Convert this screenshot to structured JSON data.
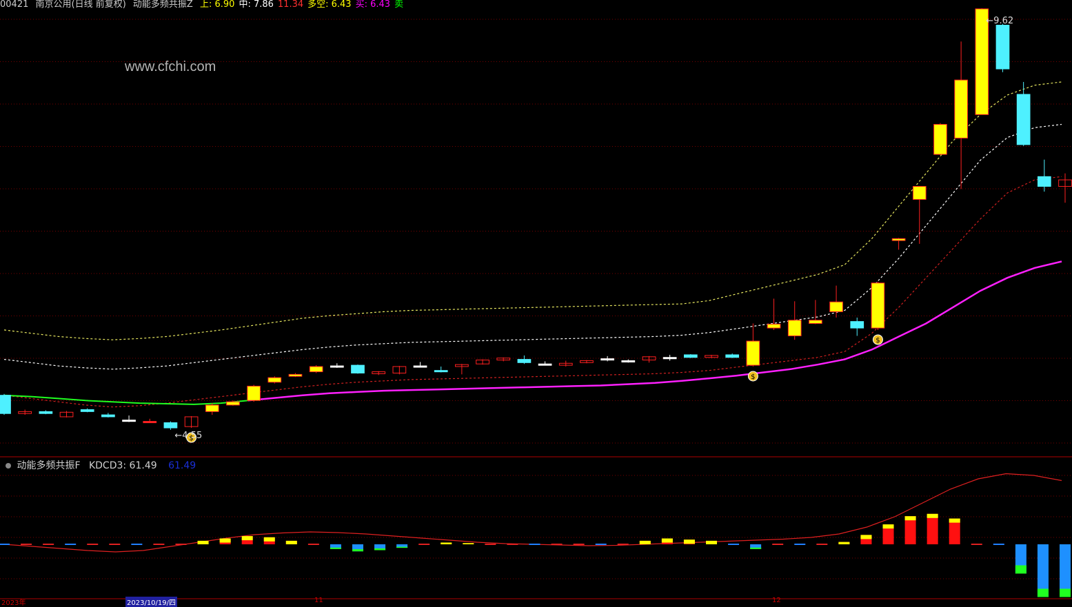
{
  "header": {
    "stock_code": "00421",
    "stock_name_period": "南京公用(日线 前复权)",
    "indicator_name": "动能多频共振Z",
    "indicator_values": [
      {
        "label": "上",
        "value": "6.90",
        "color": "#ffff00"
      },
      {
        "label": "中",
        "value": "7.86",
        "color": "#ffffff"
      },
      {
        "label": "",
        "value": "11.34",
        "color": "#ff3030"
      },
      {
        "label": "多空",
        "value": "6.43",
        "color": "#ffff00"
      },
      {
        "label": "买",
        "value": "6.43",
        "color": "#ff00ff"
      },
      {
        "label": "卖",
        "value": "",
        "color": "#00ff00"
      }
    ]
  },
  "watermark": "www.cfchi.com",
  "annotations": {
    "high_label": "9.62",
    "low_label": "4.55"
  },
  "sub_panel": {
    "title": "动能多频共振F",
    "kdcd_label": "KDCD3: 61.49",
    "kdcd_value2": "61.49"
  },
  "date_axis": {
    "labels": [
      "2023年",
      "2023/10/19/四",
      "11",
      "12"
    ]
  },
  "colors": {
    "up": "#ffff00",
    "down": "#4ef0ff",
    "flat": "#ffffff",
    "red": "#ff2020",
    "magenta": "#ff20ff",
    "green": "#20ff20",
    "grid": "#7a0000"
  },
  "chart_data": {
    "type": "candlestick",
    "price_range": [
      4.2,
      9.8
    ],
    "candles": [
      {
        "o": 5.0,
        "c": 4.72,
        "h": 5.02,
        "l": 4.7,
        "k": "down"
      },
      {
        "o": 4.72,
        "c": 4.75,
        "h": 4.78,
        "l": 4.7,
        "k": "hollow"
      },
      {
        "o": 4.75,
        "c": 4.72,
        "h": 4.77,
        "l": 4.71,
        "k": "down"
      },
      {
        "o": 4.67,
        "c": 4.74,
        "h": 4.76,
        "l": 4.66,
        "k": "hollow"
      },
      {
        "o": 4.78,
        "c": 4.75,
        "h": 4.8,
        "l": 4.74,
        "k": "down"
      },
      {
        "o": 4.7,
        "c": 4.67,
        "h": 4.73,
        "l": 4.66,
        "k": "down"
      },
      {
        "o": 4.62,
        "c": 4.62,
        "h": 4.69,
        "l": 4.59,
        "k": "flat"
      },
      {
        "o": 4.6,
        "c": 4.6,
        "h": 4.64,
        "l": 4.58,
        "k": "red"
      },
      {
        "o": 4.58,
        "c": 4.5,
        "h": 4.6,
        "l": 4.47,
        "k": "down"
      },
      {
        "o": 4.52,
        "c": 4.67,
        "h": 4.68,
        "l": 4.5,
        "k": "hollow"
      },
      {
        "o": 4.75,
        "c": 4.85,
        "h": 4.88,
        "l": 4.7,
        "k": "up"
      },
      {
        "o": 4.85,
        "c": 4.9,
        "h": 4.92,
        "l": 4.84,
        "k": "up"
      },
      {
        "o": 4.92,
        "c": 5.14,
        "h": 5.16,
        "l": 4.9,
        "k": "up"
      },
      {
        "o": 5.2,
        "c": 5.27,
        "h": 5.29,
        "l": 5.18,
        "k": "up"
      },
      {
        "o": 5.29,
        "c": 5.32,
        "h": 5.34,
        "l": 5.28,
        "k": "up"
      },
      {
        "o": 5.36,
        "c": 5.44,
        "h": 5.46,
        "l": 5.34,
        "k": "up"
      },
      {
        "o": 5.45,
        "c": 5.45,
        "h": 5.49,
        "l": 5.42,
        "k": "flat"
      },
      {
        "o": 5.46,
        "c": 5.34,
        "h": 5.47,
        "l": 5.33,
        "k": "down"
      },
      {
        "o": 5.33,
        "c": 5.36,
        "h": 5.37,
        "l": 5.31,
        "k": "hollow"
      },
      {
        "o": 5.34,
        "c": 5.44,
        "h": 5.45,
        "l": 5.32,
        "k": "hollow"
      },
      {
        "o": 5.45,
        "c": 5.45,
        "h": 5.51,
        "l": 5.43,
        "k": "flat"
      },
      {
        "o": 5.38,
        "c": 5.38,
        "h": 5.44,
        "l": 5.35,
        "k": "down"
      },
      {
        "o": 5.44,
        "c": 5.47,
        "h": 5.48,
        "l": 5.32,
        "k": "hollow"
      },
      {
        "o": 5.48,
        "c": 5.54,
        "h": 5.55,
        "l": 5.47,
        "k": "hollow"
      },
      {
        "o": 5.54,
        "c": 5.57,
        "h": 5.58,
        "l": 5.52,
        "k": "hollow"
      },
      {
        "o": 5.55,
        "c": 5.5,
        "h": 5.61,
        "l": 5.48,
        "k": "down"
      },
      {
        "o": 5.48,
        "c": 5.48,
        "h": 5.52,
        "l": 5.46,
        "k": "flat"
      },
      {
        "o": 5.46,
        "c": 5.49,
        "h": 5.53,
        "l": 5.44,
        "k": "hollow"
      },
      {
        "o": 5.5,
        "c": 5.53,
        "h": 5.54,
        "l": 5.49,
        "k": "hollow"
      },
      {
        "o": 5.56,
        "c": 5.56,
        "h": 5.6,
        "l": 5.52,
        "k": "flat"
      },
      {
        "o": 5.53,
        "c": 5.53,
        "h": 5.55,
        "l": 5.5,
        "k": "flat"
      },
      {
        "o": 5.54,
        "c": 5.59,
        "h": 5.6,
        "l": 5.5,
        "k": "hollow"
      },
      {
        "o": 5.58,
        "c": 5.58,
        "h": 5.62,
        "l": 5.53,
        "k": "flat"
      },
      {
        "o": 5.62,
        "c": 5.58,
        "h": 5.63,
        "l": 5.57,
        "k": "down"
      },
      {
        "o": 5.58,
        "c": 5.61,
        "h": 5.62,
        "l": 5.57,
        "k": "hollow"
      },
      {
        "o": 5.62,
        "c": 5.58,
        "h": 5.64,
        "l": 5.57,
        "k": "down"
      },
      {
        "o": 5.46,
        "c": 5.83,
        "h": 6.1,
        "l": 5.44,
        "k": "up"
      },
      {
        "o": 6.03,
        "c": 6.09,
        "h": 6.48,
        "l": 6.0,
        "k": "up"
      },
      {
        "o": 5.91,
        "c": 6.15,
        "h": 6.44,
        "l": 5.85,
        "k": "up"
      },
      {
        "o": 6.1,
        "c": 6.15,
        "h": 6.46,
        "l": 6.09,
        "k": "up"
      },
      {
        "o": 6.28,
        "c": 6.43,
        "h": 6.68,
        "l": 6.19,
        "k": "up"
      },
      {
        "o": 6.13,
        "c": 6.03,
        "h": 6.19,
        "l": 5.91,
        "k": "down"
      },
      {
        "o": 6.03,
        "c": 6.72,
        "h": 6.74,
        "l": 6.0,
        "k": "up"
      },
      {
        "o": 7.37,
        "c": 7.4,
        "h": 7.41,
        "l": 7.23,
        "k": "up"
      },
      {
        "o": 8.0,
        "c": 8.2,
        "h": 8.2,
        "l": 7.32,
        "k": "up"
      },
      {
        "o": 8.69,
        "c": 9.15,
        "h": 9.17,
        "l": 8.68,
        "k": "up"
      },
      {
        "o": 8.94,
        "c": 9.83,
        "h": 10.42,
        "l": 8.16,
        "k": "up"
      },
      {
        "o": 9.3,
        "c": 10.92,
        "h": 10.93,
        "l": 9.3,
        "k": "up"
      },
      {
        "o": 10.67,
        "c": 10.0,
        "h": 10.69,
        "l": 9.95,
        "k": "down"
      },
      {
        "o": 9.61,
        "c": 8.84,
        "h": 9.8,
        "l": 8.82,
        "k": "down"
      },
      {
        "o": 8.35,
        "c": 8.2,
        "h": 8.61,
        "l": 8.12,
        "k": "down"
      },
      {
        "o": 8.2,
        "c": 8.3,
        "h": 8.4,
        "l": 7.95,
        "k": "hollow"
      }
    ],
    "lines": {
      "upper": [
        6.0,
        5.95,
        5.9,
        5.87,
        5.85,
        5.87,
        5.9,
        5.95,
        6.0,
        6.06,
        6.12,
        6.18,
        6.22,
        6.25,
        6.28,
        6.3,
        6.31,
        6.32,
        6.33,
        6.34,
        6.35,
        6.36,
        6.37,
        6.38,
        6.39,
        6.4,
        6.45,
        6.55,
        6.65,
        6.75,
        6.85,
        7.0,
        7.4,
        7.9,
        8.4,
        8.9,
        9.3,
        9.6,
        9.75,
        9.8
      ],
      "mid": [
        5.55,
        5.5,
        5.45,
        5.42,
        5.4,
        5.42,
        5.45,
        5.5,
        5.55,
        5.6,
        5.65,
        5.7,
        5.74,
        5.77,
        5.79,
        5.81,
        5.82,
        5.83,
        5.84,
        5.85,
        5.86,
        5.87,
        5.88,
        5.89,
        5.9,
        5.92,
        5.96,
        6.02,
        6.08,
        6.14,
        6.2,
        6.3,
        6.65,
        7.1,
        7.6,
        8.1,
        8.6,
        8.95,
        9.1,
        9.15
      ],
      "lower": [
        5.0,
        4.95,
        4.9,
        4.85,
        4.82,
        4.84,
        4.88,
        4.93,
        4.98,
        5.03,
        5.08,
        5.13,
        5.17,
        5.2,
        5.22,
        5.24,
        5.25,
        5.26,
        5.27,
        5.28,
        5.29,
        5.3,
        5.31,
        5.32,
        5.33,
        5.35,
        5.38,
        5.43,
        5.48,
        5.53,
        5.58,
        5.67,
        5.95,
        6.35,
        6.8,
        7.25,
        7.7,
        8.1,
        8.3,
        8.35
      ],
      "trend": [
        5.0,
        4.98,
        4.95,
        4.92,
        4.9,
        4.88,
        4.87,
        4.86,
        4.88,
        4.92,
        4.96,
        5.0,
        5.03,
        5.05,
        5.07,
        5.08,
        5.09,
        5.1,
        5.11,
        5.12,
        5.13,
        5.14,
        5.15,
        5.17,
        5.19,
        5.22,
        5.26,
        5.3,
        5.35,
        5.4,
        5.47,
        5.55,
        5.7,
        5.9,
        6.1,
        6.35,
        6.6,
        6.8,
        6.95,
        7.05
      ]
    },
    "signal_candles": [
      9,
      36,
      42
    ],
    "oscillator": {
      "line": [
        0,
        -0.6,
        -1.2,
        -1.8,
        -2.2,
        -1.8,
        -0.6,
        0.6,
        1.8,
        2.8,
        3.3,
        3.6,
        3.4,
        3.0,
        2.4,
        1.8,
        1.2,
        0.6,
        0.2,
        0,
        -0.2,
        -0.4,
        -0.3,
        0,
        0.3,
        0.6,
        0.9,
        1.2,
        1.5,
        2.0,
        3.0,
        5.0,
        8.0,
        12.0,
        16.0,
        19.0,
        20.5,
        20.0,
        18.5
      ],
      "bars": [
        0,
        0,
        0,
        0,
        0,
        0,
        0,
        0,
        0,
        0.6,
        1.0,
        1.4,
        1.2,
        0.6,
        0,
        -0.8,
        -1.2,
        -1.0,
        -0.6,
        0,
        0.3,
        0.2,
        0,
        0,
        0,
        0,
        0,
        0,
        0,
        0.6,
        1.0,
        0.8,
        0.6,
        0,
        -0.8,
        0,
        0,
        0,
        0.4,
        1.6,
        3.4,
        4.8,
        5.2,
        4.4,
        0,
        0,
        -5,
        -9,
        -9
      ]
    }
  }
}
